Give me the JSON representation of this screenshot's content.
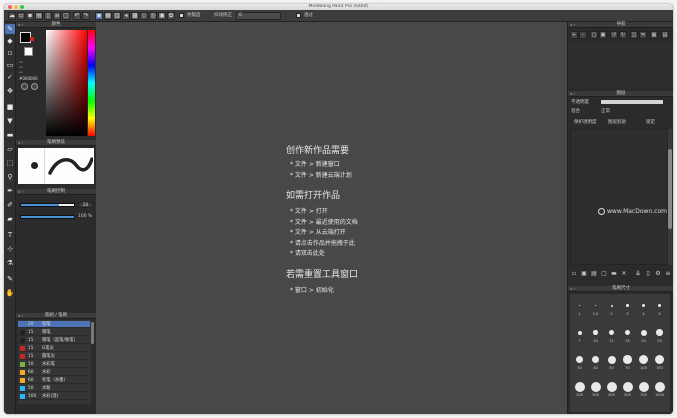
{
  "window": {
    "title": "MediBang Paint Pro (64bit)"
  },
  "toolbar": {
    "antialias_label": "抗锯齿",
    "snap_label": "抖动修正",
    "snap_value": "0",
    "extra_label": "透过"
  },
  "color_panel": {
    "title": "颜色",
    "hex_value": "#000000"
  },
  "brush_preview": {
    "title": "笔刷预览"
  },
  "brush_control": {
    "title": "笔刷控制",
    "size_value": "20",
    "opacity_value": "100 %",
    "size_fraction": 0.72,
    "opacity_fraction": 1.0
  },
  "brush_list": {
    "title": "笔刷 / 笔刷",
    "rows": [
      {
        "size": "20",
        "name": "铅笔",
        "color": "#4e74b8",
        "active": true
      },
      {
        "size": "15",
        "name": "钢笔",
        "color": "#222222",
        "active": false
      },
      {
        "size": "15",
        "name": "钢笔（起笔/收笔）",
        "color": "#222222",
        "active": false
      },
      {
        "size": "15",
        "name": "G笔尖",
        "color": "#c62828",
        "active": false
      },
      {
        "size": "15",
        "name": "圆笔尖",
        "color": "#c62828",
        "active": false
      },
      {
        "size": "10",
        "name": "水彩笔",
        "color": "#7cb342",
        "active": false
      },
      {
        "size": "60",
        "name": "水彩",
        "color": "#f9a825",
        "active": false
      },
      {
        "size": "60",
        "name": "毛笔（水墨）",
        "color": "#f9a825",
        "active": false
      },
      {
        "size": "50",
        "name": "水粉",
        "color": "#29b6f6",
        "active": false
      },
      {
        "size": "100",
        "name": "水彩(湿)",
        "color": "#29b6f6",
        "active": false
      }
    ]
  },
  "welcome": {
    "heading_new": "创作新作品需要",
    "new_items": [
      "* 文件 > 新建窗口",
      "* 文件 > 新建云端计划"
    ],
    "heading_open": "如需打开作品",
    "open_items": [
      "* 文件 > 打开",
      "* 文件 > 最近使用的文档",
      "* 文件 > 从云端打开",
      "* 请点击作品并拖拽于此",
      "* 请双击此处"
    ],
    "heading_reset": "若需重置工具窗口",
    "reset_items": [
      "* 窗口 > 初始化"
    ]
  },
  "navigator": {
    "title": "导航"
  },
  "layer_panel": {
    "title": "图层",
    "opacity_label": "不透明度",
    "blend_label": "混合",
    "blend_value": "正常",
    "protect_alpha": "保护透明度",
    "clipping": "图层剪贴",
    "lock": "锁定"
  },
  "brush_size": {
    "title": "笔刷尺寸",
    "sizes": [
      "1",
      "1.5",
      "2",
      "3",
      "4",
      "5",
      "7",
      "10",
      "12",
      "15",
      "20",
      "25",
      "30",
      "40",
      "50",
      "70",
      "100",
      "150",
      "200",
      "300",
      "400",
      "500",
      "700",
      "1000"
    ]
  },
  "watermark": "www.MacDown.com"
}
